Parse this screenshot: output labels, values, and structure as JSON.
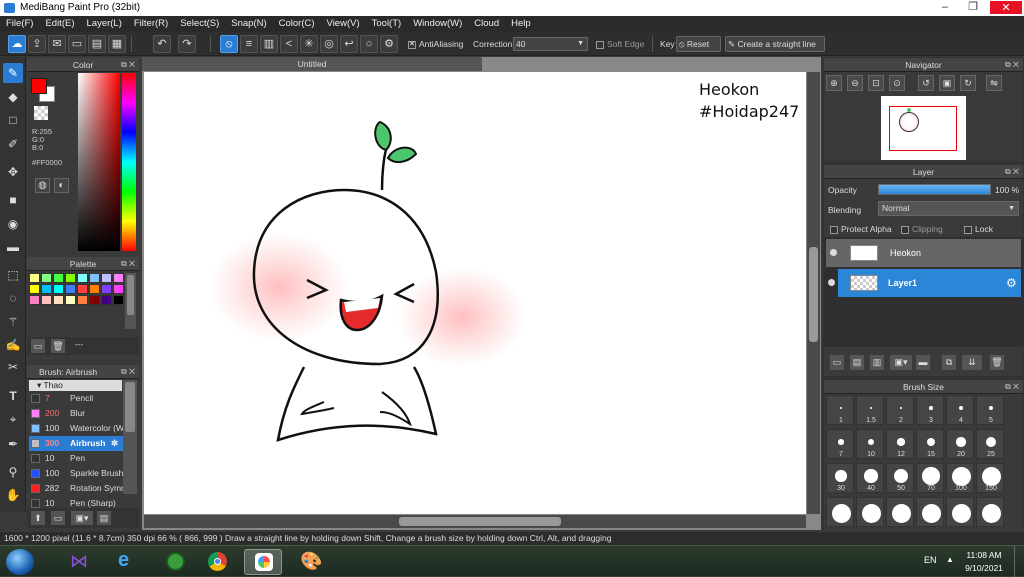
{
  "window": {
    "title": "MediBang Paint Pro (32bit)"
  },
  "menu": [
    "File(F)",
    "Edit(E)",
    "Layer(L)",
    "Filter(R)",
    "Select(S)",
    "Snap(N)",
    "Color(C)",
    "View(V)",
    "Tool(T)",
    "Window(W)",
    "Cloud",
    "Help"
  ],
  "toolbar": {
    "antialiasing_label": "AntiAliasing",
    "correction_label": "Correction",
    "correction_value": "40",
    "softedge_label": "Soft Edge",
    "key_label": "Key",
    "reset_label": "Reset",
    "straight_line_label": "Create a straight line"
  },
  "color_panel": {
    "title": "Color",
    "r": "R:255",
    "g": "G:0",
    "b": "B:0",
    "hex": "#FF0000",
    "primary_color": "#ff0000",
    "secondary_color": "#ffffff"
  },
  "palette_panel": {
    "title": "Palette",
    "input_value": "---",
    "colors": [
      "#ffff80",
      "#80ff80",
      "#40ff40",
      "#80ff00",
      "#80ffff",
      "#80c0ff",
      "#c0c0ff",
      "#ff80ff",
      "#ffff00",
      "#00c0ff",
      "#00ffff",
      "#4080ff",
      "#ff4040",
      "#ff8000",
      "#8040ff",
      "#ff40ff",
      "#ff80c0",
      "#ffc0c0",
      "#ffe0c0",
      "#ffffc0",
      "#ff8040",
      "#800000",
      "#400080",
      "#000000"
    ]
  },
  "brush_panel": {
    "title": "Brush: Airbrush",
    "group": "Thao",
    "items": [
      {
        "size": "7",
        "name": "Pencil",
        "color": "#333333"
      },
      {
        "size": "200",
        "name": "Blur",
        "color": "#ff80ff"
      },
      {
        "size": "100",
        "name": "Watercolor (Wet)",
        "color": "#80c0ff"
      },
      {
        "size": "300",
        "name": "Airbrush",
        "color": "#c0c0c0"
      },
      {
        "size": "10",
        "name": "Pen",
        "color": "#333333"
      },
      {
        "size": "100",
        "name": "Sparkle Brush",
        "color": "#2050ff"
      },
      {
        "size": "282",
        "name": "Rotation Symmetry",
        "color": "#ff2020"
      },
      {
        "size": "10",
        "name": "Pen (Sharp)",
        "color": "#333333"
      }
    ]
  },
  "document": {
    "tab_title": "Untitled",
    "watermark_line1": "Heokon",
    "watermark_line2": "#Hoidap247"
  },
  "navigator": {
    "title": "Navigator"
  },
  "layer_panel": {
    "title": "Layer",
    "opacity_label": "Opacity",
    "opacity_value": "100 %",
    "opacity_fraction": 1.0,
    "blending_label": "Blending",
    "blending_value": "Normal",
    "protect_alpha_label": "Protect Alpha",
    "clipping_label": "Clipping",
    "lock_label": "Lock",
    "layers": [
      {
        "name": "Heokon",
        "selected": false
      },
      {
        "name": "Layer1",
        "selected": true
      }
    ]
  },
  "brush_size_panel": {
    "title": "Brush Size",
    "sizes": [
      "1",
      "1.5",
      "2",
      "3",
      "4",
      "5",
      "7",
      "10",
      "12",
      "15",
      "20",
      "25",
      "30",
      "40",
      "50",
      "70",
      "100",
      "150"
    ]
  },
  "statusbar": {
    "text": "1600 * 1200 pixel  (11.6 * 8.7cm)  350 dpi  66 %  ( 866, 999 )  Draw a straight line by holding down Shift, Change a brush size by holding down Ctrl, Alt, and dragging"
  },
  "taskbar": {
    "language": "EN",
    "time": "11:08 AM",
    "date": "9/10/2021"
  }
}
